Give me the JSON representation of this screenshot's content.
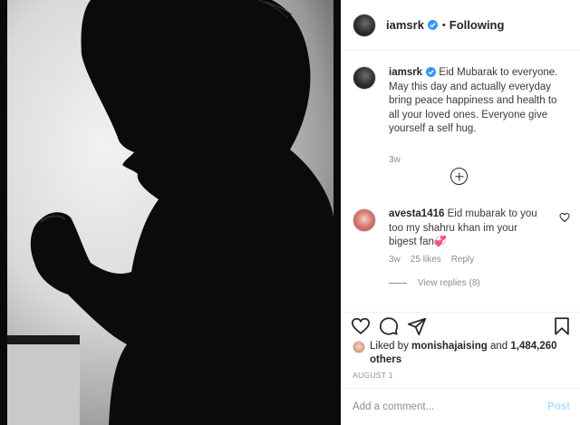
{
  "header": {
    "username": "iamsrk",
    "dot": "•",
    "follow_label": "Following"
  },
  "caption": {
    "username": "iamsrk",
    "text": "Eid Mubarak to everyone. May this day and actually everyday bring peace happiness and health to all your loved ones. Everyone give yourself a self hug.",
    "time": "3w"
  },
  "reply": {
    "username": "avesta1416",
    "text": "Eid mubarak to you too my shahru khan im your bigest fan💞",
    "time": "3w",
    "likes": "25 likes",
    "reply_label": "Reply",
    "view_replies": "View replies (8)"
  },
  "likes": {
    "prefix": "Liked by",
    "user": "monishajaising",
    "conj": "and",
    "others": "1,484,260 others"
  },
  "date": "AUGUST 1",
  "add_comment": {
    "placeholder": "Add a comment...",
    "post_label": "Post"
  },
  "icons": {
    "verified": "verified-badge-icon",
    "load_more": "plus-circle-icon",
    "comment_like": "heart-icon",
    "like": "heart-icon",
    "comment": "comment-bubble-icon",
    "share": "paper-plane-icon",
    "save": "bookmark-icon"
  },
  "colors": {
    "verified": "#3897f0",
    "post_disabled": "#b2dffc",
    "secondary_text": "#8e8e8e"
  }
}
